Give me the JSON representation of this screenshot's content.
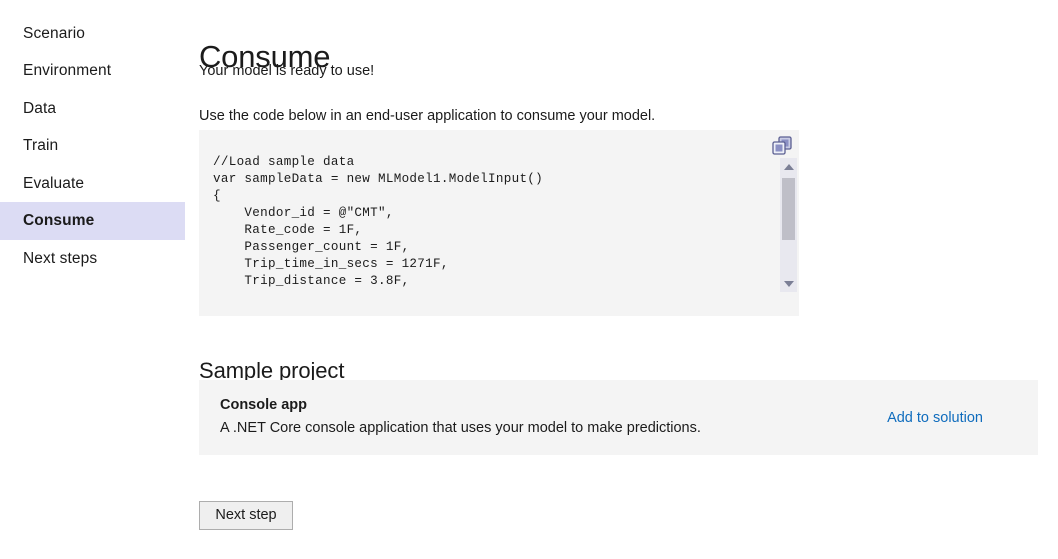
{
  "sidebar": {
    "items": [
      {
        "label": "Scenario",
        "selected": false
      },
      {
        "label": "Environment",
        "selected": false
      },
      {
        "label": "Data",
        "selected": false
      },
      {
        "label": "Train",
        "selected": false
      },
      {
        "label": "Evaluate",
        "selected": false
      },
      {
        "label": "Consume",
        "selected": true
      },
      {
        "label": "Next steps",
        "selected": false
      }
    ]
  },
  "main": {
    "title": "Consume",
    "subtitle": "Your model is ready to use!",
    "instruction": "Use the code below in an end-user application to consume your model.",
    "code": {
      "text": "//Load sample data\nvar sampleData = new MLModel1.ModelInput()\n{\n    Vendor_id = @\"CMT\",\n    Rate_code = 1F,\n    Passenger_count = 1F,\n    Trip_time_in_secs = 1271F,\n    Trip_distance = 3.8F,",
      "copy_icon": "copy-icon",
      "scroll_up_icon": "scroll-up-arrow-icon",
      "scroll_down_icon": "scroll-down-arrow-icon",
      "background": "#f4f4f4"
    },
    "sample_project": {
      "heading": "Sample project",
      "card": {
        "title": "Console app",
        "description": "A .NET Core console application that uses your model to make predictions.",
        "action_label": "Add to solution",
        "action_color": "#0f6cbd"
      }
    },
    "next_step_label": "Next step"
  },
  "colors": {
    "selected_nav_background": "#dcdcf4",
    "code_background": "#f4f4f4",
    "card_background": "#f4f4f4",
    "link": "#0f6cbd",
    "scrollbar_track": "#e8e8ef",
    "scrollbar_thumb": "#bfbfc8"
  }
}
